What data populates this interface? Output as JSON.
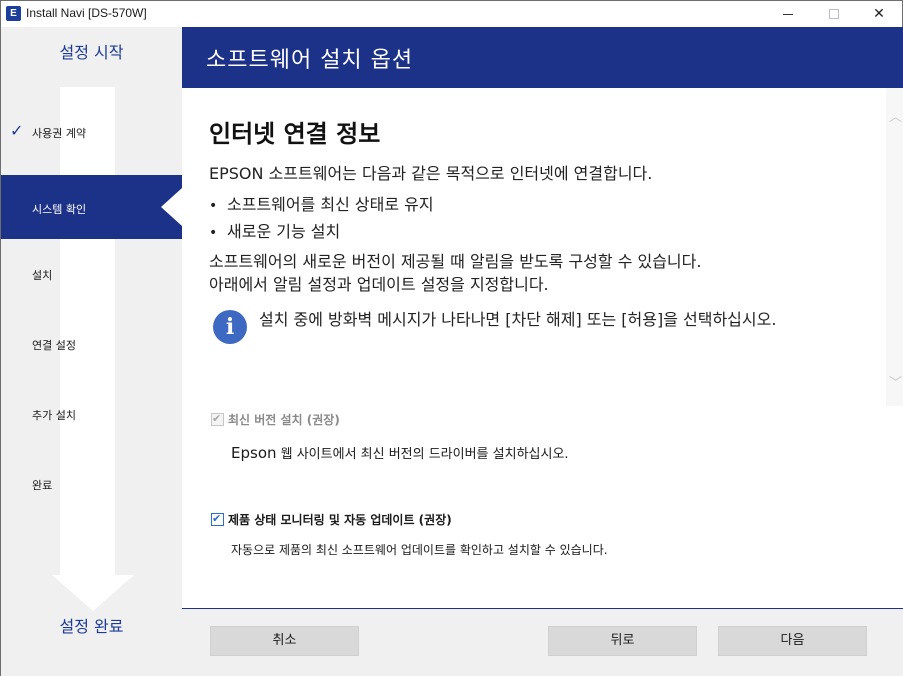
{
  "window": {
    "title": "Install Navi [DS-570W]",
    "icon_text": "E",
    "controls": {
      "minimize": "–",
      "maximize": "☐",
      "close": "✕"
    }
  },
  "sidebar": {
    "start_label": "설정 시작",
    "end_label": "설정 완료",
    "steps": [
      {
        "label": "사용권 계약",
        "state": "done"
      },
      {
        "label": "시스템 확인",
        "state": "active"
      },
      {
        "label": "설치",
        "state": "pending"
      },
      {
        "label": "연결 설정",
        "state": "pending"
      },
      {
        "label": "추가 설치",
        "state": "pending"
      },
      {
        "label": "완료",
        "state": "pending"
      }
    ],
    "check_glyph": "✓"
  },
  "header": {
    "title": "소프트웨어 설치 옵션"
  },
  "content": {
    "heading": "인터넷 연결 정보",
    "intro": "EPSON 소프트웨어는 다음과 같은 목적으로 인터넷에 연결합니다.",
    "bullets": [
      "소프트웨어를 최신 상태로 유지",
      "새로운 기능 설치"
    ],
    "bullet_glyph": "•",
    "para_line1": "소프트웨어의 새로운 버전이 제공될 때 알림을 받도록 구성할 수 있습니다.",
    "para_line2": "아래에서 알림 설정과 업데이트 설정을 지정합니다.",
    "info_icon_glyph": "i",
    "info_text": "설치 중에 방화벽 메시지가 나타나면 [차단 해제] 또는 [허용]을 선택하십시오."
  },
  "options": {
    "latest_version": {
      "label": "최신 버전 설치 (권장)",
      "checked": true,
      "enabled": false,
      "desc_brand": "Epson",
      "desc_rest": " 웹 사이트에서 최신 버전의 드라이버를 설치하십시오."
    },
    "monitoring": {
      "label": "제품 상태 모니터링 및 자동 업데이트 (권장)",
      "checked": true,
      "enabled": true,
      "desc": "자동으로 제품의 최신 소프트웨어 업데이트를 확인하고 설치할 수 있습니다."
    },
    "check_glyph": "✔"
  },
  "footer": {
    "cancel_label": "취소",
    "back_label": "뒤로",
    "next_label": "다음"
  },
  "scrollbar": {
    "up_glyph": "︿",
    "down_glyph": "﹀"
  },
  "colors": {
    "brand_navy": "#1c3188",
    "sidebar_bg": "#f0f0f0",
    "accent_blue": "#3e69c2",
    "button_bg": "#d9d9d9"
  }
}
